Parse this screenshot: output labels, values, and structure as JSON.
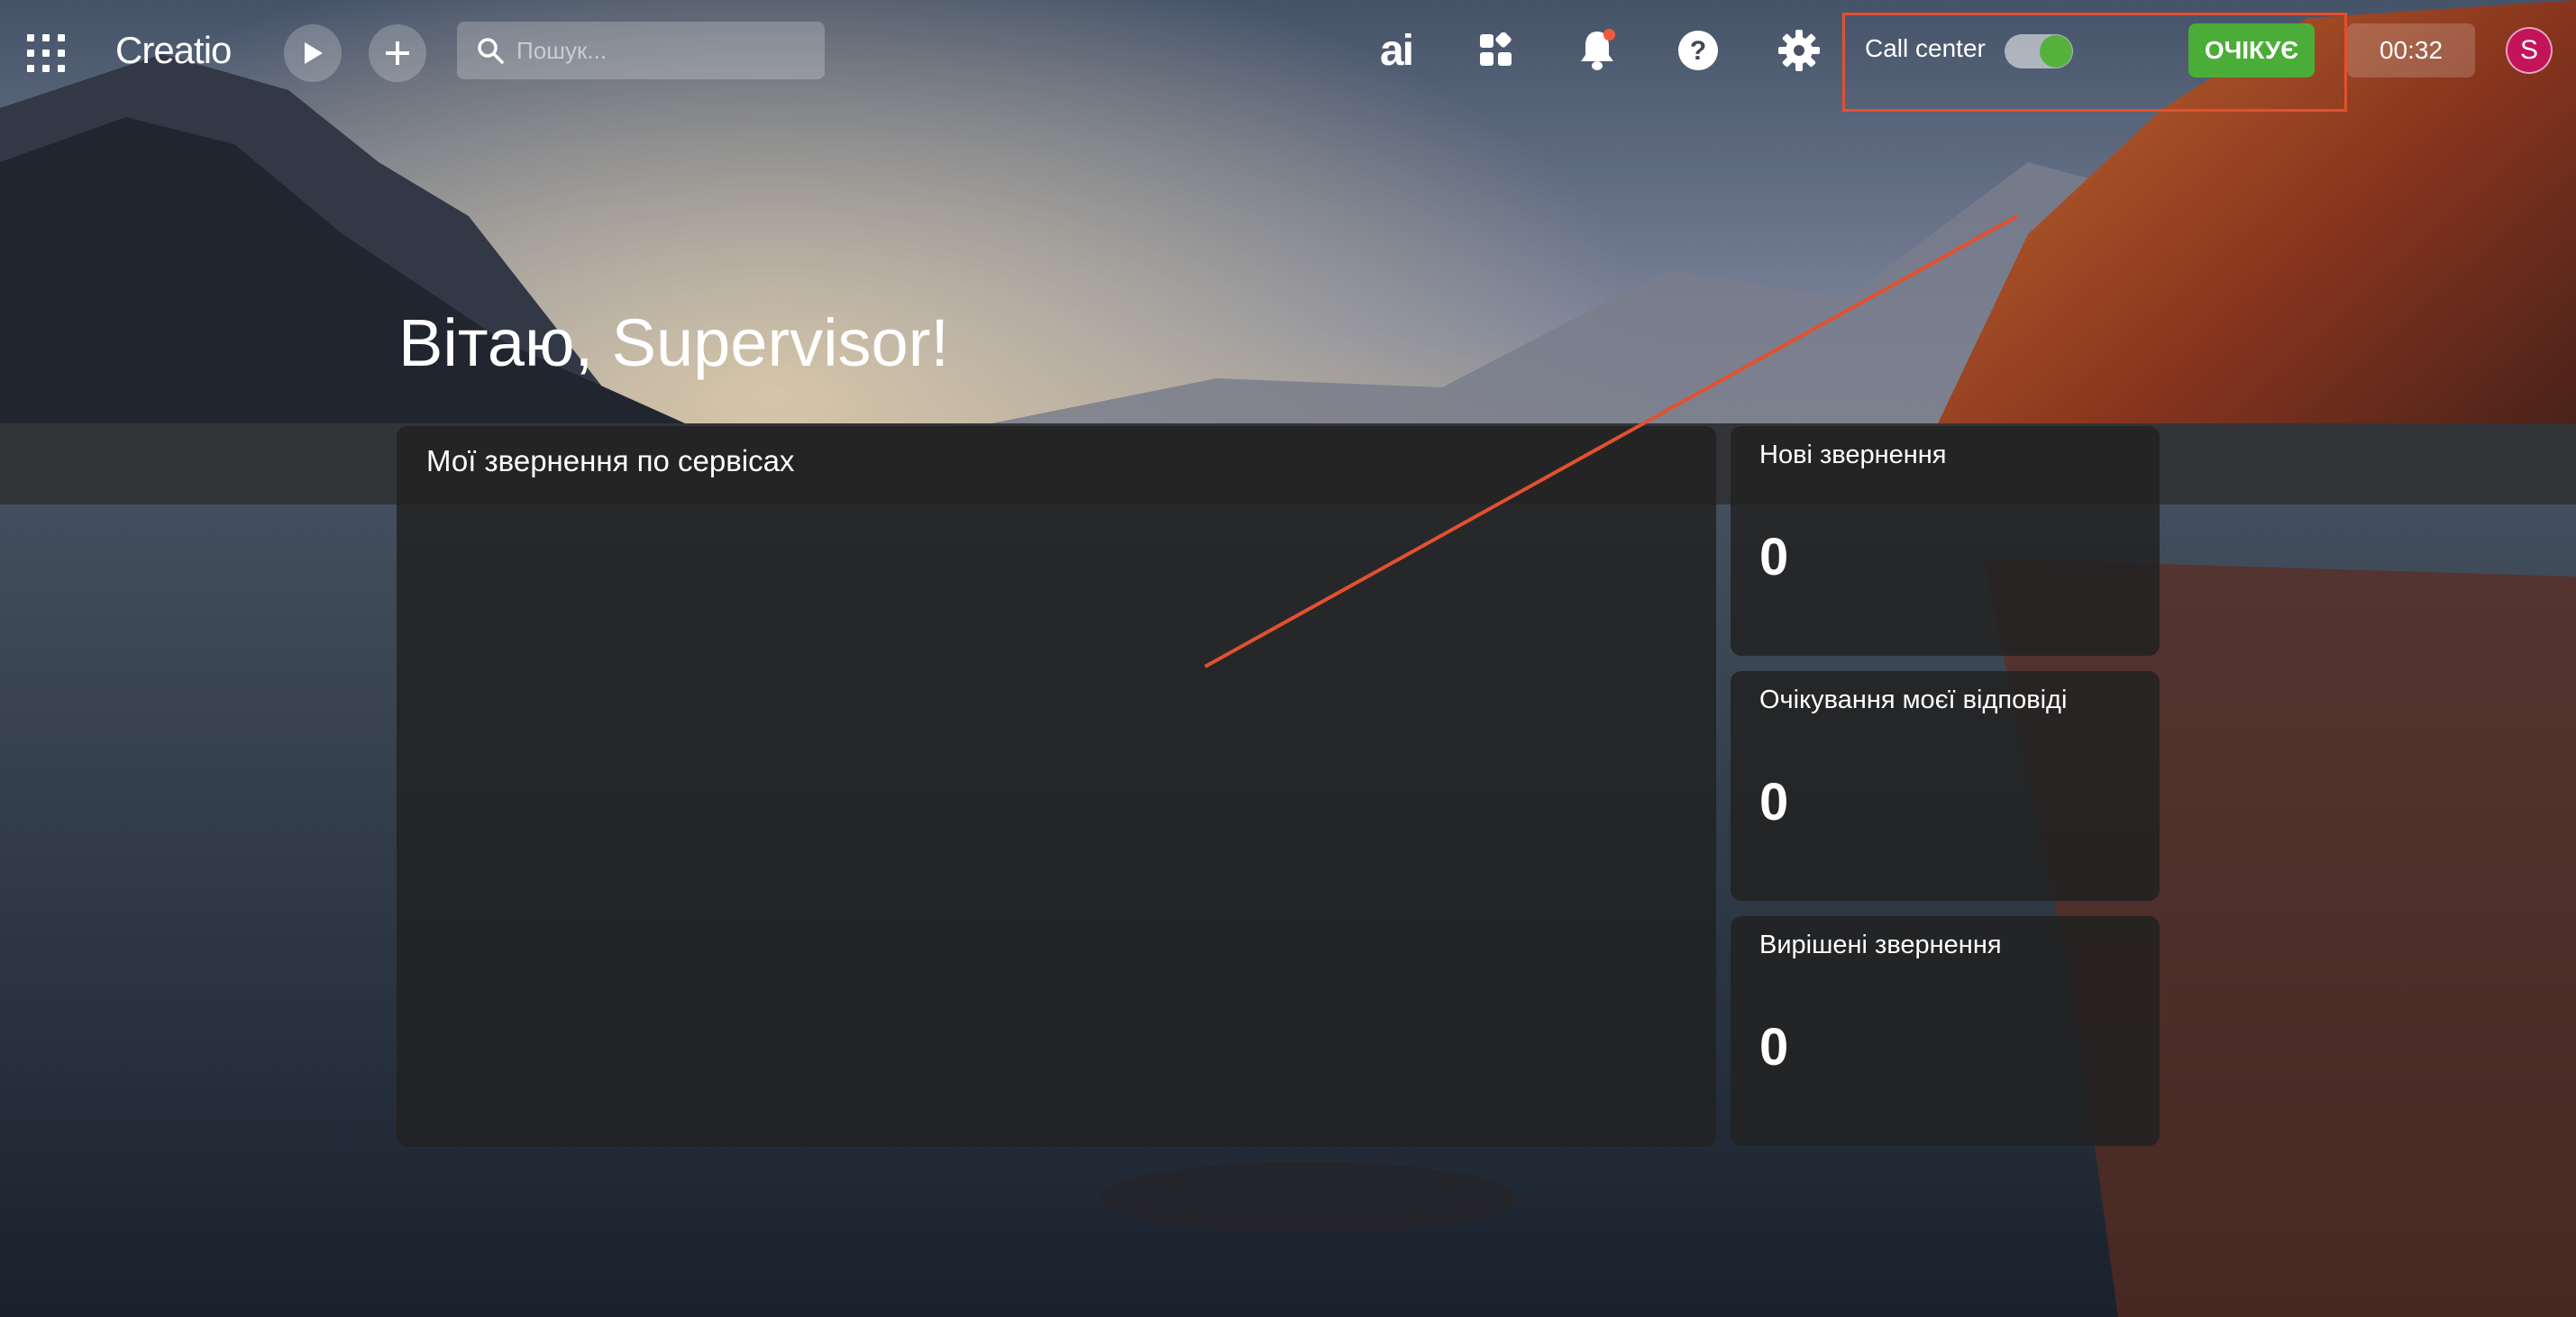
{
  "header": {
    "logo_text": "Creatio",
    "search_placeholder": "Пошук...",
    "ai_label": "ai",
    "call_center_label": "Call center",
    "call_center_enabled": true,
    "status_label": "ОЧІКУЄ",
    "timer": "00:32",
    "avatar_initial": "S"
  },
  "main": {
    "greeting": "Вітаю, Supervisor!",
    "services_panel_title": "Мої звернення по сервісах",
    "cards": [
      {
        "title": "Нові звернення",
        "value": "0"
      },
      {
        "title": "Очікування моєї відповіді",
        "value": "0"
      },
      {
        "title": "Вирішені звернення",
        "value": "0"
      }
    ]
  },
  "colors": {
    "status_green": "#4aad37",
    "avatar": "#c3145a",
    "annotation": "#e2512f",
    "notification_dot": "#ef5a3c"
  }
}
